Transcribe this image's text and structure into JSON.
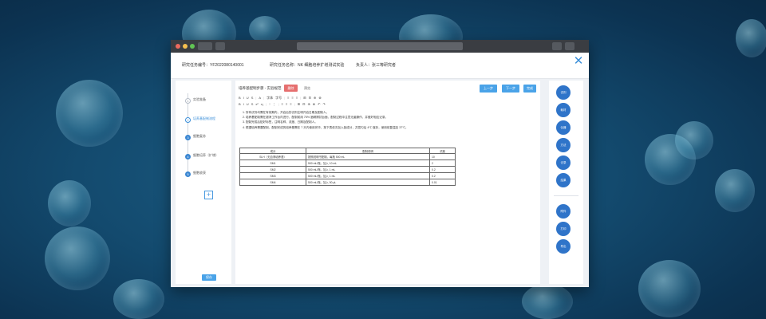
{
  "window": {
    "traffic_lights": [
      "#ed6a5e",
      "#f5bf4f",
      "#61c454"
    ]
  },
  "info": {
    "task_no": "研究任务编号：YF2022080140001",
    "task_name": "研究任务名称：NK 细胞培养扩增测试实验",
    "owner": "负责人：张三等研究者"
  },
  "steps": [
    {
      "num": "1",
      "label": "实验准备",
      "state": "done"
    },
    {
      "num": "2",
      "label": "培养基配制流程",
      "state": "active"
    },
    {
      "num": "3",
      "label": "细胞复苏",
      "state": "todo"
    },
    {
      "num": "4",
      "label": "细胞培养（扩增）",
      "state": "todo"
    },
    {
      "num": "5",
      "label": "细胞收获",
      "state": "todo"
    }
  ],
  "left": {
    "add_label": "+",
    "save_label": "保存"
  },
  "editor": {
    "tab_title": "培养基配制步骤 - 实验规范",
    "badge": "删除",
    "preview": "预览",
    "prev_label": "上一步",
    "next_label": "下一步",
    "done_label": "完成",
    "toolbar_row1": [
      "B",
      "I",
      "U",
      "S",
      "|",
      "A",
      "|",
      "字体",
      "字号",
      "|",
      "≡",
      "≡",
      "≡",
      "|",
      "⊞",
      "⊟",
      "⊕",
      "⊗"
    ],
    "toolbar_row2": [
      "B",
      "I",
      "U",
      "S",
      "x²",
      "x₂",
      "|",
      "⁝",
      "⋮",
      "|",
      "≡",
      "≡",
      "≡",
      "|",
      "⊞",
      "⊟",
      "⊕",
      "⊗",
      "↶",
      "↷"
    ],
    "paragraphs": [
      "1. 所有试剂均需在有效期内，开启后的试剂注明开启日期及配制人。",
      "2. 培养基配制需在超净工作台内进行，配制前用 75% 酒精擦拭台面，配制过程中注意无菌操作，并做好相应记录。",
      "3. 配制完成后贴好标签，注明名称、浓度、日期及配制人。",
      "4. 根据培养需要配制，配制完成的培养基需在 7 天内使用完毕，按下表依次加入各成分，并混匀后 4℃ 保存，使用前复温至 37℃。"
    ],
    "table": {
      "headers": [
        "成分",
        "配制说明",
        "浓度"
      ],
      "rows": [
        [
          "SLH（无血清培养基）",
          "按照说明书配制，每瓶 500 mL",
          "10"
        ],
        [
          "SM1",
          "500 mL/瓶，加入 10 mL",
          "2"
        ],
        [
          "SM2",
          "500 mL/瓶，加入 1 mL",
          "0.2"
        ],
        [
          "SM3",
          "500 mL/瓶，加入 1 mL",
          "0.2"
        ],
        [
          "SM4",
          "500 mL/瓶，加入 50 μL",
          "0.01"
        ]
      ]
    }
  },
  "right_buttons_top": [
    "试剂",
    "耗材",
    "仪器",
    "方法",
    "记录",
    "结果"
  ],
  "right_buttons_bottom": [
    "附件",
    "打印",
    "导出"
  ]
}
